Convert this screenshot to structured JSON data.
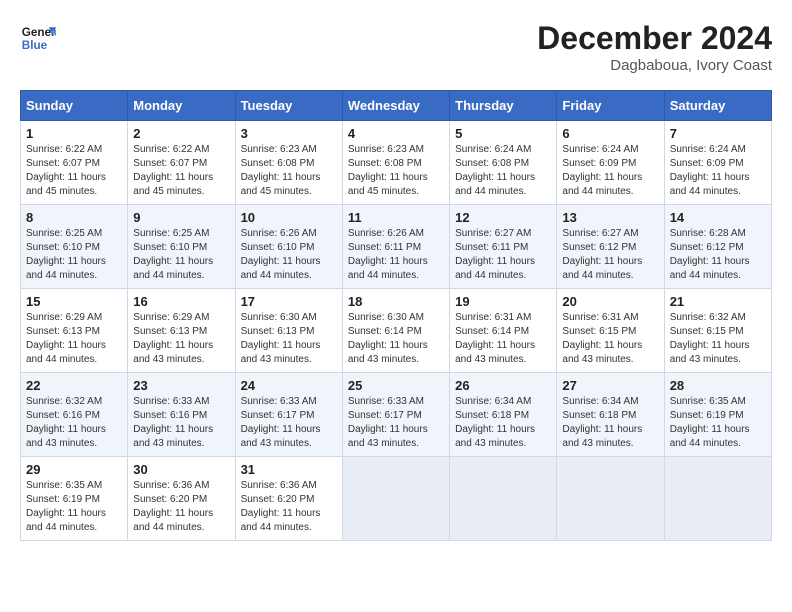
{
  "header": {
    "logo_line1": "General",
    "logo_line2": "Blue",
    "main_title": "December 2024",
    "sub_title": "Dagbaboua, Ivory Coast"
  },
  "days_of_week": [
    "Sunday",
    "Monday",
    "Tuesday",
    "Wednesday",
    "Thursday",
    "Friday",
    "Saturday"
  ],
  "weeks": [
    [
      {
        "day": "1",
        "info": "Sunrise: 6:22 AM\nSunset: 6:07 PM\nDaylight: 11 hours\nand 45 minutes."
      },
      {
        "day": "2",
        "info": "Sunrise: 6:22 AM\nSunset: 6:07 PM\nDaylight: 11 hours\nand 45 minutes."
      },
      {
        "day": "3",
        "info": "Sunrise: 6:23 AM\nSunset: 6:08 PM\nDaylight: 11 hours\nand 45 minutes."
      },
      {
        "day": "4",
        "info": "Sunrise: 6:23 AM\nSunset: 6:08 PM\nDaylight: 11 hours\nand 45 minutes."
      },
      {
        "day": "5",
        "info": "Sunrise: 6:24 AM\nSunset: 6:08 PM\nDaylight: 11 hours\nand 44 minutes."
      },
      {
        "day": "6",
        "info": "Sunrise: 6:24 AM\nSunset: 6:09 PM\nDaylight: 11 hours\nand 44 minutes."
      },
      {
        "day": "7",
        "info": "Sunrise: 6:24 AM\nSunset: 6:09 PM\nDaylight: 11 hours\nand 44 minutes."
      }
    ],
    [
      {
        "day": "8",
        "info": "Sunrise: 6:25 AM\nSunset: 6:10 PM\nDaylight: 11 hours\nand 44 minutes."
      },
      {
        "day": "9",
        "info": "Sunrise: 6:25 AM\nSunset: 6:10 PM\nDaylight: 11 hours\nand 44 minutes."
      },
      {
        "day": "10",
        "info": "Sunrise: 6:26 AM\nSunset: 6:10 PM\nDaylight: 11 hours\nand 44 minutes."
      },
      {
        "day": "11",
        "info": "Sunrise: 6:26 AM\nSunset: 6:11 PM\nDaylight: 11 hours\nand 44 minutes."
      },
      {
        "day": "12",
        "info": "Sunrise: 6:27 AM\nSunset: 6:11 PM\nDaylight: 11 hours\nand 44 minutes."
      },
      {
        "day": "13",
        "info": "Sunrise: 6:27 AM\nSunset: 6:12 PM\nDaylight: 11 hours\nand 44 minutes."
      },
      {
        "day": "14",
        "info": "Sunrise: 6:28 AM\nSunset: 6:12 PM\nDaylight: 11 hours\nand 44 minutes."
      }
    ],
    [
      {
        "day": "15",
        "info": "Sunrise: 6:29 AM\nSunset: 6:13 PM\nDaylight: 11 hours\nand 44 minutes."
      },
      {
        "day": "16",
        "info": "Sunrise: 6:29 AM\nSunset: 6:13 PM\nDaylight: 11 hours\nand 43 minutes."
      },
      {
        "day": "17",
        "info": "Sunrise: 6:30 AM\nSunset: 6:13 PM\nDaylight: 11 hours\nand 43 minutes."
      },
      {
        "day": "18",
        "info": "Sunrise: 6:30 AM\nSunset: 6:14 PM\nDaylight: 11 hours\nand 43 minutes."
      },
      {
        "day": "19",
        "info": "Sunrise: 6:31 AM\nSunset: 6:14 PM\nDaylight: 11 hours\nand 43 minutes."
      },
      {
        "day": "20",
        "info": "Sunrise: 6:31 AM\nSunset: 6:15 PM\nDaylight: 11 hours\nand 43 minutes."
      },
      {
        "day": "21",
        "info": "Sunrise: 6:32 AM\nSunset: 6:15 PM\nDaylight: 11 hours\nand 43 minutes."
      }
    ],
    [
      {
        "day": "22",
        "info": "Sunrise: 6:32 AM\nSunset: 6:16 PM\nDaylight: 11 hours\nand 43 minutes."
      },
      {
        "day": "23",
        "info": "Sunrise: 6:33 AM\nSunset: 6:16 PM\nDaylight: 11 hours\nand 43 minutes."
      },
      {
        "day": "24",
        "info": "Sunrise: 6:33 AM\nSunset: 6:17 PM\nDaylight: 11 hours\nand 43 minutes."
      },
      {
        "day": "25",
        "info": "Sunrise: 6:33 AM\nSunset: 6:17 PM\nDaylight: 11 hours\nand 43 minutes."
      },
      {
        "day": "26",
        "info": "Sunrise: 6:34 AM\nSunset: 6:18 PM\nDaylight: 11 hours\nand 43 minutes."
      },
      {
        "day": "27",
        "info": "Sunrise: 6:34 AM\nSunset: 6:18 PM\nDaylight: 11 hours\nand 43 minutes."
      },
      {
        "day": "28",
        "info": "Sunrise: 6:35 AM\nSunset: 6:19 PM\nDaylight: 11 hours\nand 44 minutes."
      }
    ],
    [
      {
        "day": "29",
        "info": "Sunrise: 6:35 AM\nSunset: 6:19 PM\nDaylight: 11 hours\nand 44 minutes."
      },
      {
        "day": "30",
        "info": "Sunrise: 6:36 AM\nSunset: 6:20 PM\nDaylight: 11 hours\nand 44 minutes."
      },
      {
        "day": "31",
        "info": "Sunrise: 6:36 AM\nSunset: 6:20 PM\nDaylight: 11 hours\nand 44 minutes."
      },
      null,
      null,
      null,
      null
    ]
  ]
}
